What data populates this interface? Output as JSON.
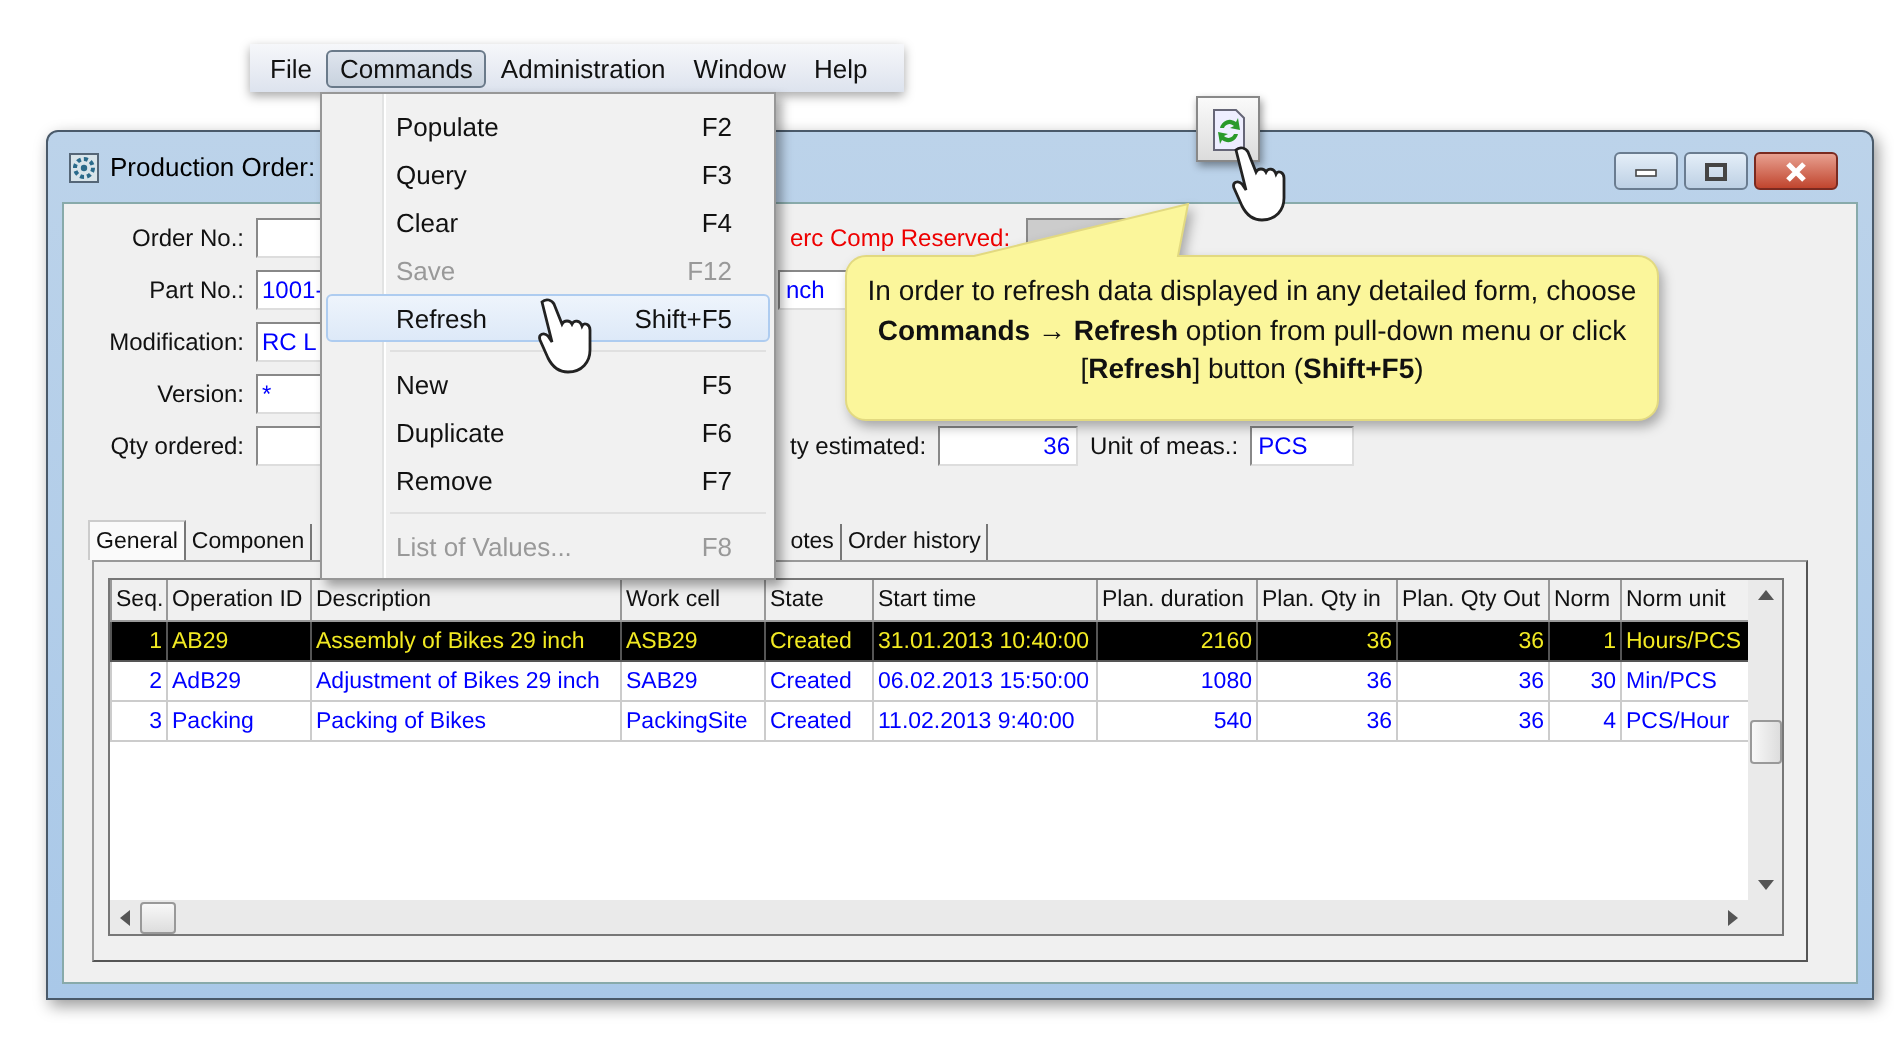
{
  "menu_bar": [
    {
      "label": "File",
      "selected": false
    },
    {
      "label": "Commands",
      "selected": true
    },
    {
      "label": "Administration",
      "selected": false
    },
    {
      "label": "Window",
      "selected": false
    },
    {
      "label": "Help",
      "selected": false
    }
  ],
  "menu": [
    {
      "label": "Populate",
      "shortcut": "F2",
      "disabled": false,
      "selected": false,
      "separator_before": false
    },
    {
      "label": "Query",
      "shortcut": "F3",
      "disabled": false,
      "selected": false,
      "separator_before": false
    },
    {
      "label": "Clear",
      "shortcut": "F4",
      "disabled": false,
      "selected": false,
      "separator_before": false
    },
    {
      "label": "Save",
      "shortcut": "F12",
      "disabled": true,
      "selected": false,
      "separator_before": false
    },
    {
      "label": "Refresh",
      "shortcut": "Shift+F5",
      "disabled": false,
      "selected": true,
      "separator_before": false
    },
    {
      "label": "New",
      "shortcut": "F5",
      "disabled": false,
      "selected": false,
      "separator_before": true
    },
    {
      "label": "Duplicate",
      "shortcut": "F6",
      "disabled": false,
      "selected": false,
      "separator_before": false
    },
    {
      "label": "Remove",
      "shortcut": "F7",
      "disabled": false,
      "selected": false,
      "separator_before": false
    },
    {
      "label": "List of Values...",
      "shortcut": "F8",
      "disabled": true,
      "selected": false,
      "separator_before": true
    }
  ],
  "callout": {
    "text": "In order to refresh data displayed in any detailed form, choose **Commands**  → **Refresh** option from pull-down menu or click [**Refresh**] button (**Shift+F5**)"
  },
  "window": {
    "title": "Production Order:"
  },
  "form": {
    "rows": [
      {
        "label": "Order No.:",
        "right": [
          {
            "kind": "label",
            "text": "erc Comp Reserved:",
            "alert": true
          },
          {
            "kind": "readonly"
          }
        ]
      },
      {
        "label": "Part No.:",
        "value": "1001-",
        "right": [
          {
            "kind": "field",
            "value": "nch"
          }
        ]
      },
      {
        "label": "Modification:",
        "value": "RC L",
        "right": []
      },
      {
        "label": "Version:",
        "value": "*",
        "right": []
      },
      {
        "label": "Qty ordered:",
        "right": [
          {
            "kind": "label",
            "text": "ty estimated:",
            "alert": false
          },
          {
            "kind": "number",
            "value": "36"
          },
          {
            "kind": "label",
            "text": "Unit of meas.:",
            "alert": false
          },
          {
            "kind": "field",
            "value": "PCS"
          }
        ]
      }
    ]
  },
  "tabs": [
    {
      "label": "General",
      "selected": true
    },
    {
      "label": "Componen",
      "selected": false
    },
    {
      "label": "otes",
      "selected": false
    },
    {
      "label": "Order history",
      "selected": false
    }
  ],
  "table": {
    "columns": [
      "Seq.",
      "Operation ID",
      "Description",
      "Work cell",
      "State",
      "Start time",
      "Plan. duration",
      "Plan. Qty in",
      "Plan. Qty Out",
      "Norm",
      "Norm unit"
    ],
    "rows": [
      {
        "selected": true,
        "cells": [
          "1",
          "AB29",
          "Assembly of Bikes 29 inch",
          "ASB29",
          "Created",
          "31.01.2013 10:40:00",
          "2160",
          "36",
          "36",
          "1",
          "Hours/PCS"
        ]
      },
      {
        "selected": false,
        "cells": [
          "2",
          "AdB29",
          "Adjustment of Bikes 29 inch",
          "SAB29",
          "Created",
          "06.02.2013 15:50:00",
          "1080",
          "36",
          "36",
          "30",
          "Min/PCS"
        ]
      },
      {
        "selected": false,
        "cells": [
          "3",
          "Packing",
          "Packing of Bikes",
          "PackingSite",
          "Created",
          "11.02.2013 9:40:00",
          "540",
          "36",
          "36",
          "4",
          "PCS/Hour"
        ]
      }
    ]
  }
}
